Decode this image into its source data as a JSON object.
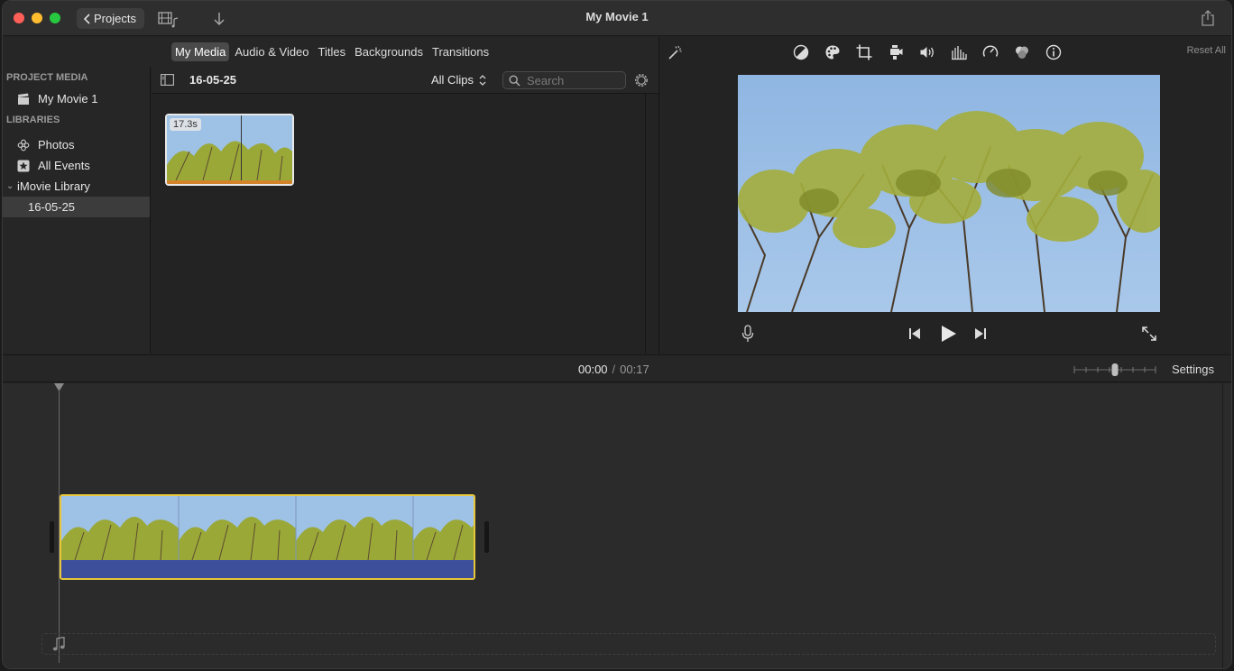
{
  "window": {
    "title": "My Movie 1"
  },
  "toolbar": {
    "projects_label": "Projects",
    "media_icon": "film-music-icon",
    "import_icon": "download-arrow-icon",
    "share_icon": "share-icon"
  },
  "browser_tabs": [
    {
      "label": "My Media",
      "active": true
    },
    {
      "label": "Audio & Video",
      "active": false
    },
    {
      "label": "Titles",
      "active": false
    },
    {
      "label": "Backgrounds",
      "active": false
    },
    {
      "label": "Transitions",
      "active": false
    }
  ],
  "sidebar": {
    "project_media_heading": "PROJECT MEDIA",
    "project_item": "My Movie 1",
    "libraries_heading": "LIBRARIES",
    "photos": "Photos",
    "all_events": "All Events",
    "library_name": "iMovie Library",
    "event_name": "16-05-25"
  },
  "browser": {
    "event_title": "16-05-25",
    "filter_label": "All Clips",
    "search_placeholder": "Search",
    "clips": [
      {
        "duration": "17.3s"
      }
    ]
  },
  "viewer": {
    "reset_all_label": "Reset All",
    "tools": [
      "magic-wand-icon",
      "color-balance-icon",
      "color-palette-icon",
      "crop-icon",
      "stabilization-icon",
      "volume-icon",
      "equalizer-icon",
      "speed-icon",
      "clip-filter-icon",
      "info-icon"
    ],
    "colors": {
      "sky": "#9ec1e6",
      "foliage": "#9aa838"
    }
  },
  "timeline": {
    "current_time": "00:00",
    "separator": "/",
    "duration": "00:17",
    "settings_label": "Settings",
    "zoom_level": 0.5,
    "clip_highlight_color": "#e6c63a",
    "audio_color": "#3d4f9a"
  }
}
